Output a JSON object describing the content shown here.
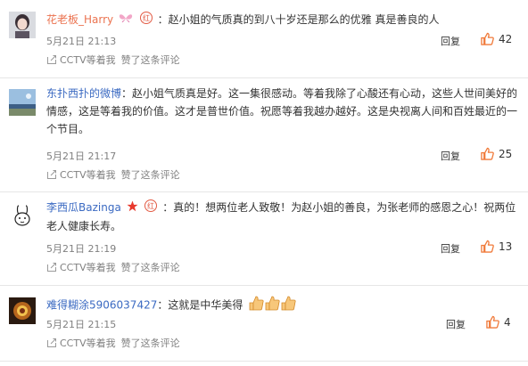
{
  "comments": [
    {
      "user": "花老板_Harry",
      "text": "：赵小姐的气质真的到八十岁还是那么的优雅 真是善良的人",
      "time": "5月21日 21:13",
      "reply": "回复",
      "likes": "42",
      "sub1": "CCTV等着我",
      "sub2": "赞了这条评论",
      "badges": [
        "butterfly-badge",
        "red-v-badge"
      ]
    },
    {
      "user": "东扑西扑的微博",
      "text": "：赵小姐气质真是好。这一集很感动。等着我除了心酸还有心动，这些人世间美好的情感，这是等着我的价值。这才是普世价值。祝愿等着我越办越好。这是央视离人间和百姓最近的一个节目。",
      "time": "5月21日 21:17",
      "reply": "回复",
      "likes": "25",
      "sub1": "CCTV等着我",
      "sub2": "赞了这条评论",
      "badges": []
    },
    {
      "user": "李西瓜Bazinga",
      "text": "：真的！想两位老人致敬！为赵小姐的善良，为张老师的感恩之心！祝两位老人健康长寿。",
      "time": "5月21日 21:19",
      "reply": "回复",
      "likes": "13",
      "sub1": "CCTV等着我",
      "sub2": "赞了这条评论",
      "badges": [
        "star-badge",
        "red-v-badge"
      ]
    },
    {
      "user": "难得糊涂5906037427",
      "text": "：这就是中华美得",
      "time": "5月21日 21:15",
      "reply": "回复",
      "likes": "4",
      "sub1": "CCTV等着我",
      "sub2": "赞了这条评论",
      "badges": []
    }
  ],
  "colors": {
    "username_orange": "#eb7350",
    "username_blue": "#3b6ac2",
    "like_orange": "#f07a3a",
    "meta_gray": "#808080"
  }
}
